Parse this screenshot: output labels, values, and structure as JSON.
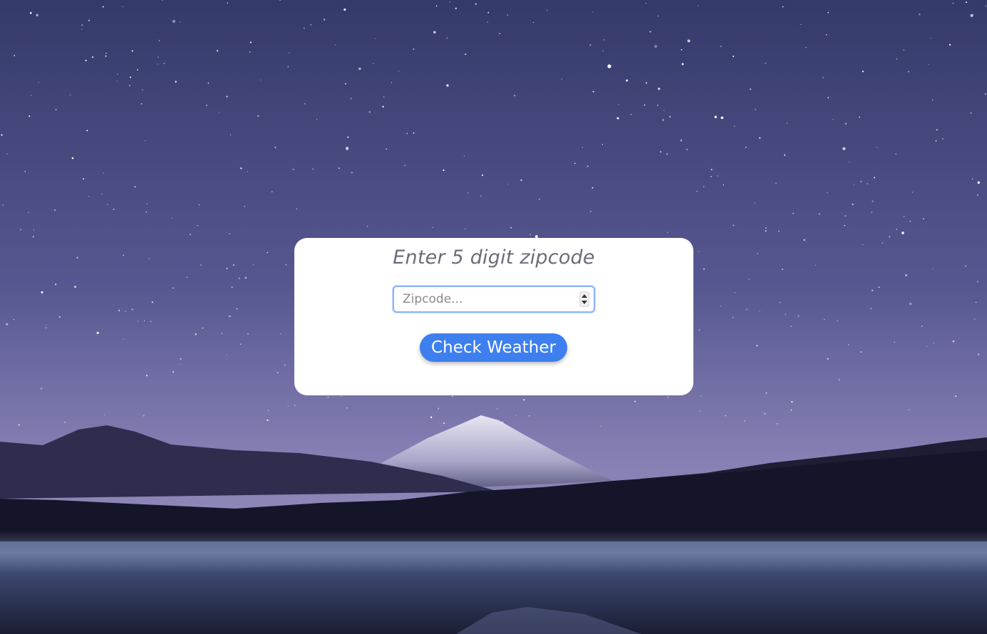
{
  "background": {
    "scene": "starry night sky over snow-capped mountain and lake",
    "colors": {
      "sky_top": "#343a6a",
      "sky_mid": "#5b5a92",
      "sky_horizon": "#8a84b6",
      "hills": "#2a2a48",
      "treeline": "#17172a",
      "lake": "#3e4a72"
    }
  },
  "card": {
    "prompt": "Enter 5 digit zipcode",
    "zip_placeholder": "Zipcode...",
    "zip_value": "",
    "button_label": "Check Weather",
    "button_color": "#3d7fef"
  }
}
